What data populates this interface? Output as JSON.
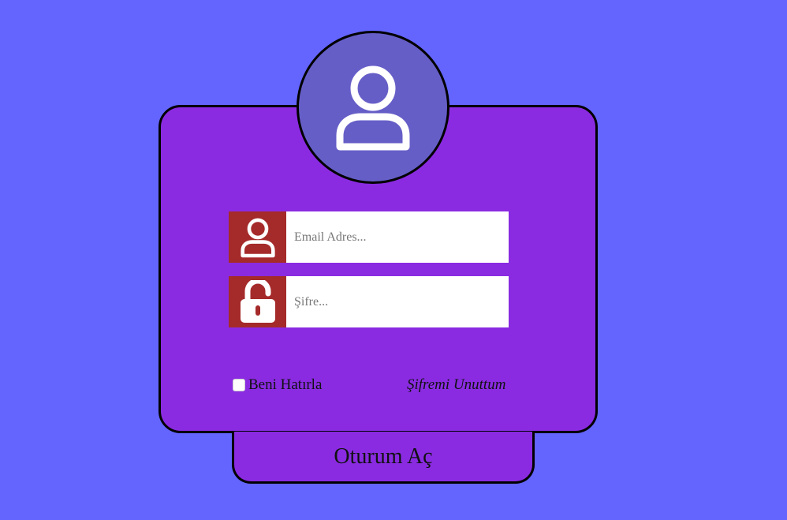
{
  "login": {
    "email_placeholder": "Email Adres...",
    "password_placeholder": "Şifre...",
    "remember_label": "Beni Hatırla",
    "forgot_label": "Şifremi Unuttum",
    "submit_label": "Oturum Aç"
  },
  "icons": {
    "avatar": "user-icon",
    "email": "user-icon",
    "password": "unlock-icon"
  },
  "colors": {
    "background": "#6464ff",
    "card": "#8a2be2",
    "avatar_circle": "#665ec7",
    "icon_box": "#a52a2a"
  }
}
